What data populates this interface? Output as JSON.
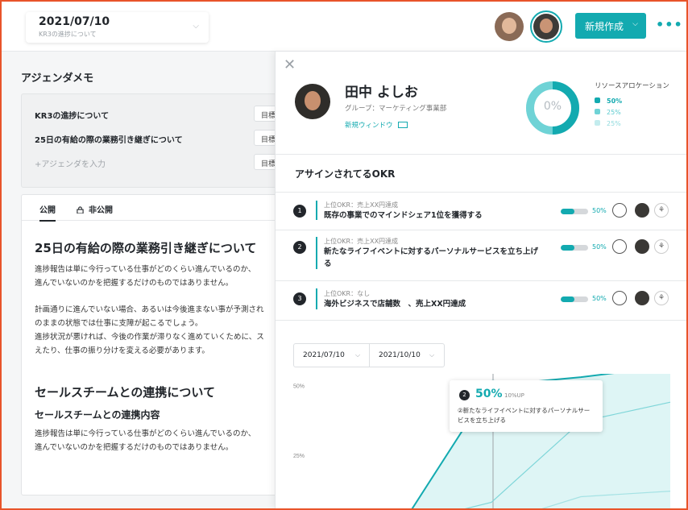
{
  "header": {
    "date_value": "2021/07/10",
    "date_sub": "KR3の進捗について",
    "new_button": "新規作成",
    "more_icon": "more-dots-icon"
  },
  "agenda": {
    "title": "アジェンダメモ",
    "items": [
      {
        "label": "KR3の進捗について",
        "tag": "目標"
      },
      {
        "label": "25日の有給の際の業務引き継ぎについて",
        "tag": "目標"
      }
    ],
    "add_placeholder": "+アジェンダを入力",
    "add_tag": "目標"
  },
  "memo": {
    "tab_public": "公開",
    "tab_private": "非公開",
    "heading1": "25日の有給の際の業務引き継ぎについて",
    "para1": "進捗報告は単に今行っている仕事がどのくらい進んでいるのか、\n進んでいないのかを把握するだけのものではありません。",
    "para2": "計画通りに進んでいない場合、あるいは今後進まない事が予測され\nのままの状態では仕事に支障が起こるでしょう。\n進捗状況が悪ければ、今後の作業が滞りなく進めていくために、ス\nえたり、仕事の振り分けを変える必要があります。",
    "heading2": "セールスチームとの連携について",
    "heading3": "セールスチームとの連携内容",
    "para3": "進捗報告は単に今行っている仕事がどのくらい進んでいるのか、\n進んでいないのかを把握するだけのものではありません。"
  },
  "profile": {
    "name": "田中 よしお",
    "group": "グループ：マーケティング事業部",
    "link": "新規ウィンドウ",
    "donut_label": "0%",
    "resource_title": "リソースアロケーション",
    "resources": [
      {
        "label": "50%",
        "color": "#13aab0"
      },
      {
        "label": "25%",
        "color": "#6fd3d6"
      },
      {
        "label": "25%",
        "color": "#c3ecee"
      }
    ]
  },
  "okr": {
    "heading": "アサインされてるOKR",
    "rows": [
      {
        "num": "1",
        "parent": "上位OKR：売上XX円達成",
        "title": "既存の事業でのマインドシェア1位を獲得する",
        "progress": 50,
        "pct": "50%"
      },
      {
        "num": "2",
        "parent": "上位OKR：売上XX円達成",
        "title": "新たなライフイベントに対するパーソナルサービスを立ち上げる",
        "progress": 50,
        "pct": "50%"
      },
      {
        "num": "3",
        "parent": "上位OKR：なし",
        "title": "海外ビジネスで店舗数　、売上XX円達成",
        "progress": 50,
        "pct": "50%"
      }
    ]
  },
  "range": {
    "from": "2021/07/10",
    "to": "2021/10/10"
  },
  "tooltip": {
    "num": "2",
    "pct": "50%",
    "up": "10%UP",
    "desc": "②新たなライフイベントに対するパーソナルサービスを立ち上げる"
  },
  "chart_data": {
    "type": "line",
    "ylabels": [
      "50%",
      "25%"
    ],
    "ylim": [
      0,
      60
    ],
    "x": [
      0,
      1,
      2,
      3,
      4
    ],
    "series": [
      {
        "values": [
          0,
          0,
          50,
          53,
          57
        ],
        "color": "#13aab0"
      },
      {
        "values": [
          0,
          0,
          8,
          37,
          44
        ],
        "color": "#7fd6d9"
      },
      {
        "values": [
          0,
          0,
          0,
          10,
          12
        ],
        "color": "#a5e2e4"
      }
    ]
  }
}
